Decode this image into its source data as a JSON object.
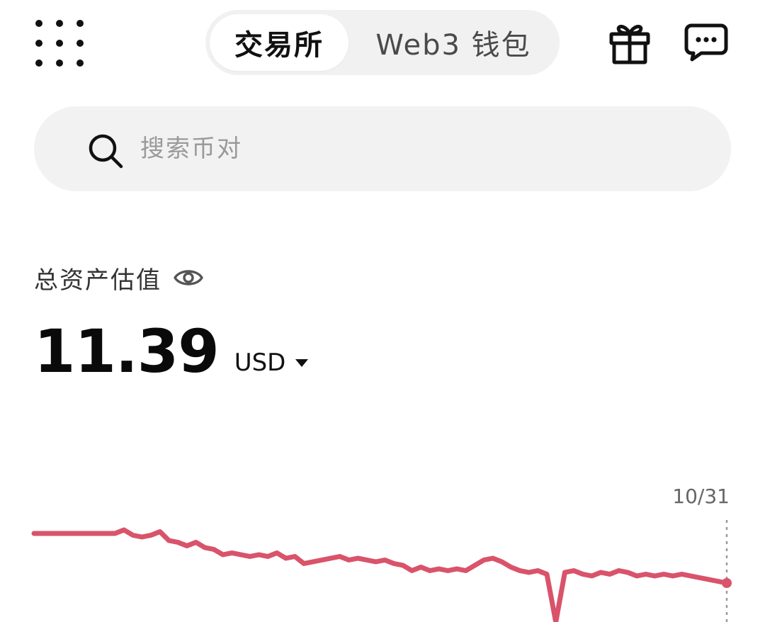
{
  "header": {
    "tabs": [
      {
        "label": "交易所",
        "active": true
      },
      {
        "label": "Web3 钱包",
        "active": false
      }
    ],
    "icons": {
      "apps": "grid-dots-icon",
      "gift": "gift-icon",
      "messages": "chat-bubble-icon"
    }
  },
  "search": {
    "placeholder": "搜索币对",
    "icon": "search-icon"
  },
  "assets": {
    "label": "总资产估值",
    "value": "11.39",
    "currency": "USD",
    "visibility_icon": "eye-icon"
  },
  "chart_data": {
    "type": "line",
    "end_date_label": "10/31",
    "color": "#d9536b",
    "values": [
      100,
      100,
      100,
      100,
      100,
      100,
      100,
      100,
      100,
      100,
      101,
      99.5,
      99,
      99.5,
      100.5,
      98,
      97.5,
      96.5,
      97.5,
      96,
      95.5,
      94,
      94.5,
      94,
      93.5,
      94,
      93.5,
      94.5,
      93,
      93.5,
      91.5,
      92,
      92.5,
      93,
      93.5,
      92.5,
      93,
      92.5,
      92,
      92.5,
      91.5,
      91,
      89.5,
      90.5,
      89.5,
      90,
      89.5,
      90,
      89.5,
      91,
      92.5,
      93,
      92,
      90.5,
      89.5,
      89,
      89.5,
      88.5,
      75,
      89,
      89.5,
      88.5,
      88,
      89,
      88.5,
      89.5,
      89,
      88,
      88.5,
      88,
      88.5,
      88,
      88.5,
      88,
      87.5,
      87,
      86.5,
      86
    ]
  }
}
